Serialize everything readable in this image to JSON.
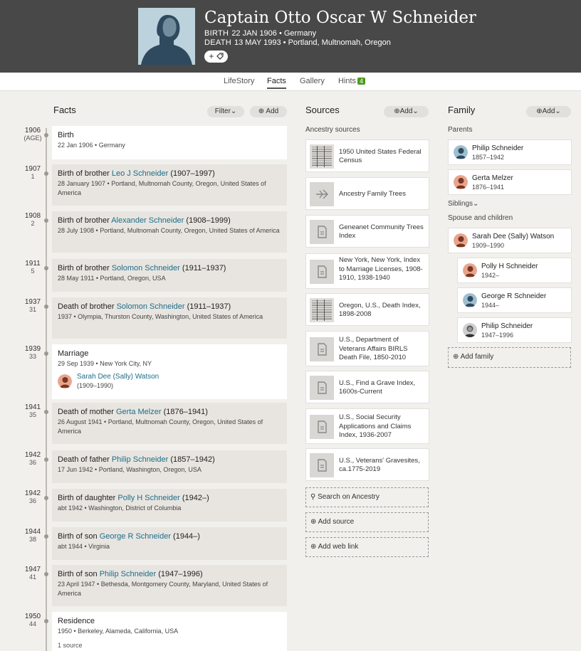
{
  "header": {
    "name": "Captain Otto Oscar W Schneider",
    "birth_label": "BIRTH",
    "birth_value": "22 JAN 1906 • Germany",
    "death_label": "DEATH",
    "death_value": "13 MAY 1993 • Portland, Multnomah, Oregon",
    "add_tag_label": "+"
  },
  "tabs": [
    {
      "label": "LifeStory"
    },
    {
      "label": "Facts"
    },
    {
      "label": "Gallery"
    },
    {
      "label": "Hints",
      "badge": "4"
    }
  ],
  "facts": {
    "title": "Facts",
    "filter_label": "Filter",
    "add_label": "Add",
    "items": [
      {
        "year": "1906",
        "age": "(AGE)",
        "title": "Birth",
        "detail": "22 Jan 1906 • Germany"
      },
      {
        "year": "1907",
        "age": "1",
        "prefix": "Birth of brother ",
        "person": "Leo J Schneider",
        "years": " (1907–1997)",
        "detail": "28 January 1907 • Portland, Multnomah County, Oregon, United States of America"
      },
      {
        "year": "1908",
        "age": "2",
        "prefix": "Birth of brother ",
        "person": "Alexander Schneider",
        "years": " (1908–1999)",
        "detail": "28 July 1908 • Portland, Multnomah County, Oregon, United States of America"
      },
      {
        "year": "1911",
        "age": "5",
        "prefix": "Birth of brother ",
        "person": "Solomon Schneider",
        "years": " (1911–1937)",
        "detail": "28 May 1911 • Portland, Oregon, USA"
      },
      {
        "year": "1937",
        "age": "31",
        "prefix": "Death of brother ",
        "person": "Solomon Schneider",
        "years": " (1911–1937)",
        "detail": "1937 • Olympia, Thurston County, Washington, United States of America"
      },
      {
        "year": "1939",
        "age": "33",
        "title": "Marriage",
        "detail": "29 Sep 1939 • New York City, NY",
        "spouse_name": "Sarah Dee (Sally) Watson",
        "spouse_years": "(1909–1990)"
      },
      {
        "year": "1941",
        "age": "35",
        "prefix": "Death of mother ",
        "person": "Gerta Melzer",
        "years": " (1876–1941)",
        "detail": "26 August 1941 • Portland, Multnomah County, Oregon, United States of America"
      },
      {
        "year": "1942",
        "age": "36",
        "prefix": "Death of father ",
        "person": "Philip Schneider",
        "years": " (1857–1942)",
        "detail": "17 Jun 1942 • Portland, Washington, Oregon, USA"
      },
      {
        "year": "1942",
        "age": "36",
        "prefix": "Birth of daughter ",
        "person": "Polly H Schneider",
        "years": " (1942–)",
        "detail": "abt 1942 • Washington, District of Columbia"
      },
      {
        "year": "1944",
        "age": "38",
        "prefix": "Birth of son ",
        "person": "George R Schneider",
        "years": " (1944–)",
        "detail": "abt 1944 • Virginia"
      },
      {
        "year": "1947",
        "age": "41",
        "prefix": "Birth of son ",
        "person": "Philip Schneider",
        "years": " (1947–1996)",
        "detail": "23 April 1947 • Bethesda, Montgomery County, Maryland, United States of America"
      },
      {
        "year": "1950",
        "age": "44",
        "title": "Residence",
        "detail": "1950 • Berkeley, Alameda, California, USA",
        "sources": "1 source"
      }
    ]
  },
  "sources": {
    "title": "Sources",
    "add_label": "Add",
    "subheading": "Ancestry sources",
    "items": [
      {
        "text": "1950 United States Federal Census",
        "thumb": "census-image"
      },
      {
        "text": "Ancestry Family Trees",
        "thumb": "tree-icon"
      },
      {
        "text": "Geneanet Community Trees Index",
        "thumb": "document-icon"
      },
      {
        "text": "New York, New York, Index to Marriage Licenses, 1908-1910, 1938-1940",
        "thumb": "document-icon"
      },
      {
        "text": "Oregon, U.S., Death Index, 1898-2008",
        "thumb": "census-image"
      },
      {
        "text": "U.S., Department of Veterans Affairs BIRLS Death File, 1850-2010",
        "thumb": "document-icon"
      },
      {
        "text": "U.S., Find a Grave Index, 1600s-Current",
        "thumb": "document-icon"
      },
      {
        "text": "U.S., Social Security Applications and Claims Index, 1936-2007",
        "thumb": "document-icon"
      },
      {
        "text": "U.S., Veterans' Gravesites, ca.1775-2019",
        "thumb": "document-icon"
      }
    ],
    "search_label": "Search on Ancestry",
    "add_source_label": "Add source",
    "add_web_link_label": "Add web link"
  },
  "family": {
    "title": "Family",
    "add_label": "Add",
    "parents_label": "Parents",
    "parents": [
      {
        "name": "Philip Schneider",
        "years": "1857–1942",
        "gender": "male"
      },
      {
        "name": "Gerta Melzer",
        "years": "1876–1941",
        "gender": "female"
      }
    ],
    "siblings_label": "Siblings",
    "spouse_label": "Spouse and children",
    "spouse": {
      "name": "Sarah Dee (Sally) Watson",
      "years": "1909–1990",
      "gender": "female"
    },
    "children": [
      {
        "name": "Polly H Schneider",
        "years": "1942–",
        "gender": "female"
      },
      {
        "name": "George R Schneider",
        "years": "1944–",
        "gender": "male"
      },
      {
        "name": "Philip Schneider",
        "years": "1947–1996",
        "gender": "photo"
      }
    ],
    "add_family_label": "Add family"
  },
  "colors": {
    "header_bg": "#484848",
    "link": "#1d6d8a",
    "hint_badge": "#4d9a1f",
    "male_avatar": "#9fbfd0",
    "female_avatar": "#e8a58c"
  }
}
